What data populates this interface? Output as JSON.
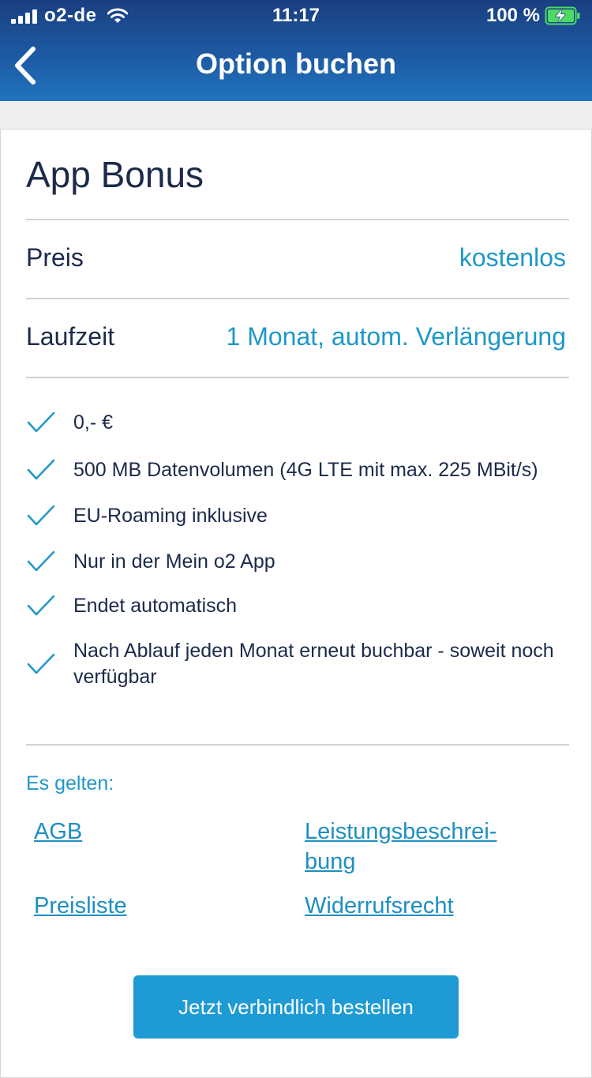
{
  "status_bar": {
    "carrier": "o2-de",
    "time": "11:17",
    "battery_percent": "100 %",
    "battery_level": 1.0,
    "icons": [
      "signal-icon",
      "wifi-icon",
      "battery-charging-icon"
    ]
  },
  "header": {
    "title": "Option buchen",
    "back_icon": "chevron-left-icon"
  },
  "product": {
    "name": "App Bonus",
    "price_label": "Preis",
    "price_value": "kostenlos",
    "term_label": "Laufzeit",
    "term_value": "1 Monat, autom. Verlängerung"
  },
  "features": [
    "0,- €",
    "500 MB Datenvolumen (4G LTE mit max. 225 MBit/s)",
    "EU-Roaming inklusive",
    "Nur in der Mein o2 App",
    "Endet automatisch",
    "Nach Ablauf jeden Monat erneut buchbar - soweit noch verfügbar"
  ],
  "terms": {
    "heading": "Es gelten:",
    "agb": "AGB",
    "leistung": "Leistungsbeschrei-bung",
    "preisliste": "Preisliste",
    "widerruf": "Widerrufsrecht"
  },
  "actions": {
    "order_label": "Jetzt verbindlich bestellen"
  },
  "colors": {
    "header_top": "#1a3f80",
    "header_bottom": "#2173bd",
    "accent": "#1e98c8",
    "button": "#1e9ad5",
    "text_dark": "#1c2a4a",
    "battery_green": "#4cd964"
  }
}
